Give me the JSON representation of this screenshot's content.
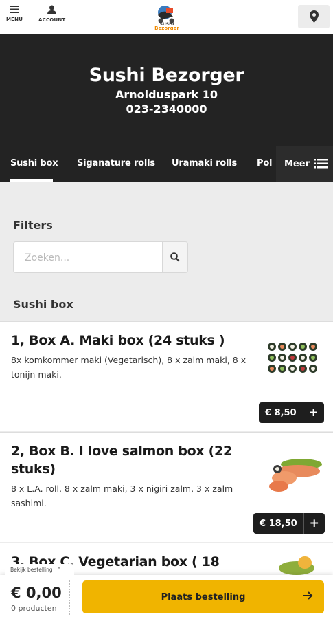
{
  "topnav": {
    "menu_label": "MENU",
    "account_label": "ACCOUNT",
    "logo_text": "Sushi Bezorger"
  },
  "hero": {
    "name": "Sushi Bezorger",
    "address": "Arnolduspark 10",
    "phone": "023-2340000"
  },
  "tabs": {
    "items": [
      {
        "label": "Sushi box",
        "active": true
      },
      {
        "label": "Siganature rolls",
        "active": false
      },
      {
        "label": "Uramaki rolls",
        "active": false
      },
      {
        "label": "Pol",
        "active": false
      }
    ],
    "more_label": "Meer"
  },
  "filters": {
    "title": "Filters",
    "search_placeholder": "Zoeken..."
  },
  "section": {
    "title": "Sushi box"
  },
  "products": [
    {
      "title": "1, Box A. Maki box (24 stuks )",
      "description": "8x komkommer maki (Vegetarisch), 8 x zalm maki, 8 x tonijn maki.",
      "price": "€ 8,50"
    },
    {
      "title": "2, Box B. I love salmon box (22 stuks)",
      "description": "8 x L.A. roll, 8 x zalm maki, 3 x nigiri zalm, 3 x zalm sashimi.",
      "price": "€ 18,50"
    },
    {
      "title": "3, Box C. Vegetarian box ( 18",
      "description": "",
      "price": ""
    }
  ],
  "cart": {
    "view_order_label": "Bekijk bestelling",
    "total": "€ 0,00",
    "count": "0 producten",
    "order_button": "Plaats bestelling"
  },
  "colors": {
    "accent": "#f0b400",
    "dark": "#232323"
  }
}
